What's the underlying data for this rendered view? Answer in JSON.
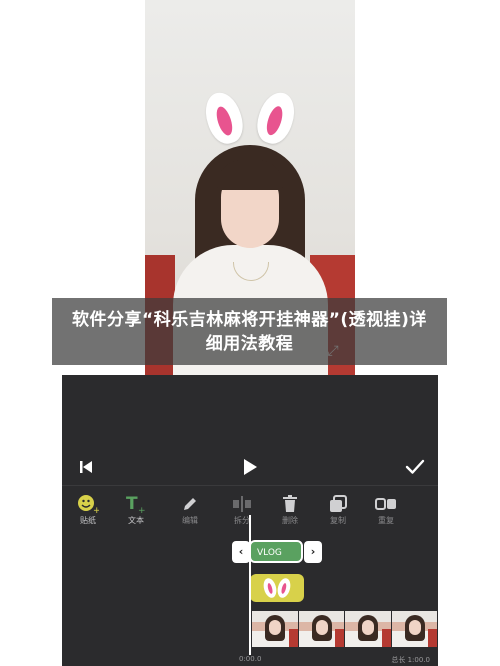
{
  "overlay": {
    "title": "软件分享“科乐吉林麻将开挂神器”(透视挂)详细用法教程"
  },
  "preview": {
    "expand_icon": "expand-diagonal-icon"
  },
  "editor": {
    "controls": {
      "prev_icon": "skip-back-icon",
      "play_icon": "play-icon",
      "done_icon": "checkmark-icon"
    },
    "toolbar": [
      {
        "label": "贴纸",
        "icon": "sticker-add-icon",
        "active": true
      },
      {
        "label": "文本",
        "icon": "text-add-icon",
        "active": true
      },
      {
        "label": "编辑",
        "icon": "pencil-icon",
        "active": false
      },
      {
        "label": "拆分",
        "icon": "split-icon",
        "active": false
      },
      {
        "label": "删除",
        "icon": "trash-icon",
        "active": false
      },
      {
        "label": "复制",
        "icon": "duplicate-icon",
        "active": false
      },
      {
        "label": "重复",
        "icon": "repeat-icon",
        "active": false
      }
    ],
    "timeline": {
      "text_clip": "VLOG",
      "left_arrow": "‹",
      "right_arrow": "›",
      "time_start": "0:00.0",
      "time_total": "总长 1:00.0"
    },
    "colors": {
      "background": "#2b2b2d",
      "sticker_icon": "#d8d14a",
      "text_icon": "#5aa160",
      "text_clip": "#5aa160",
      "sticker_clip": "#d8d14a"
    }
  }
}
